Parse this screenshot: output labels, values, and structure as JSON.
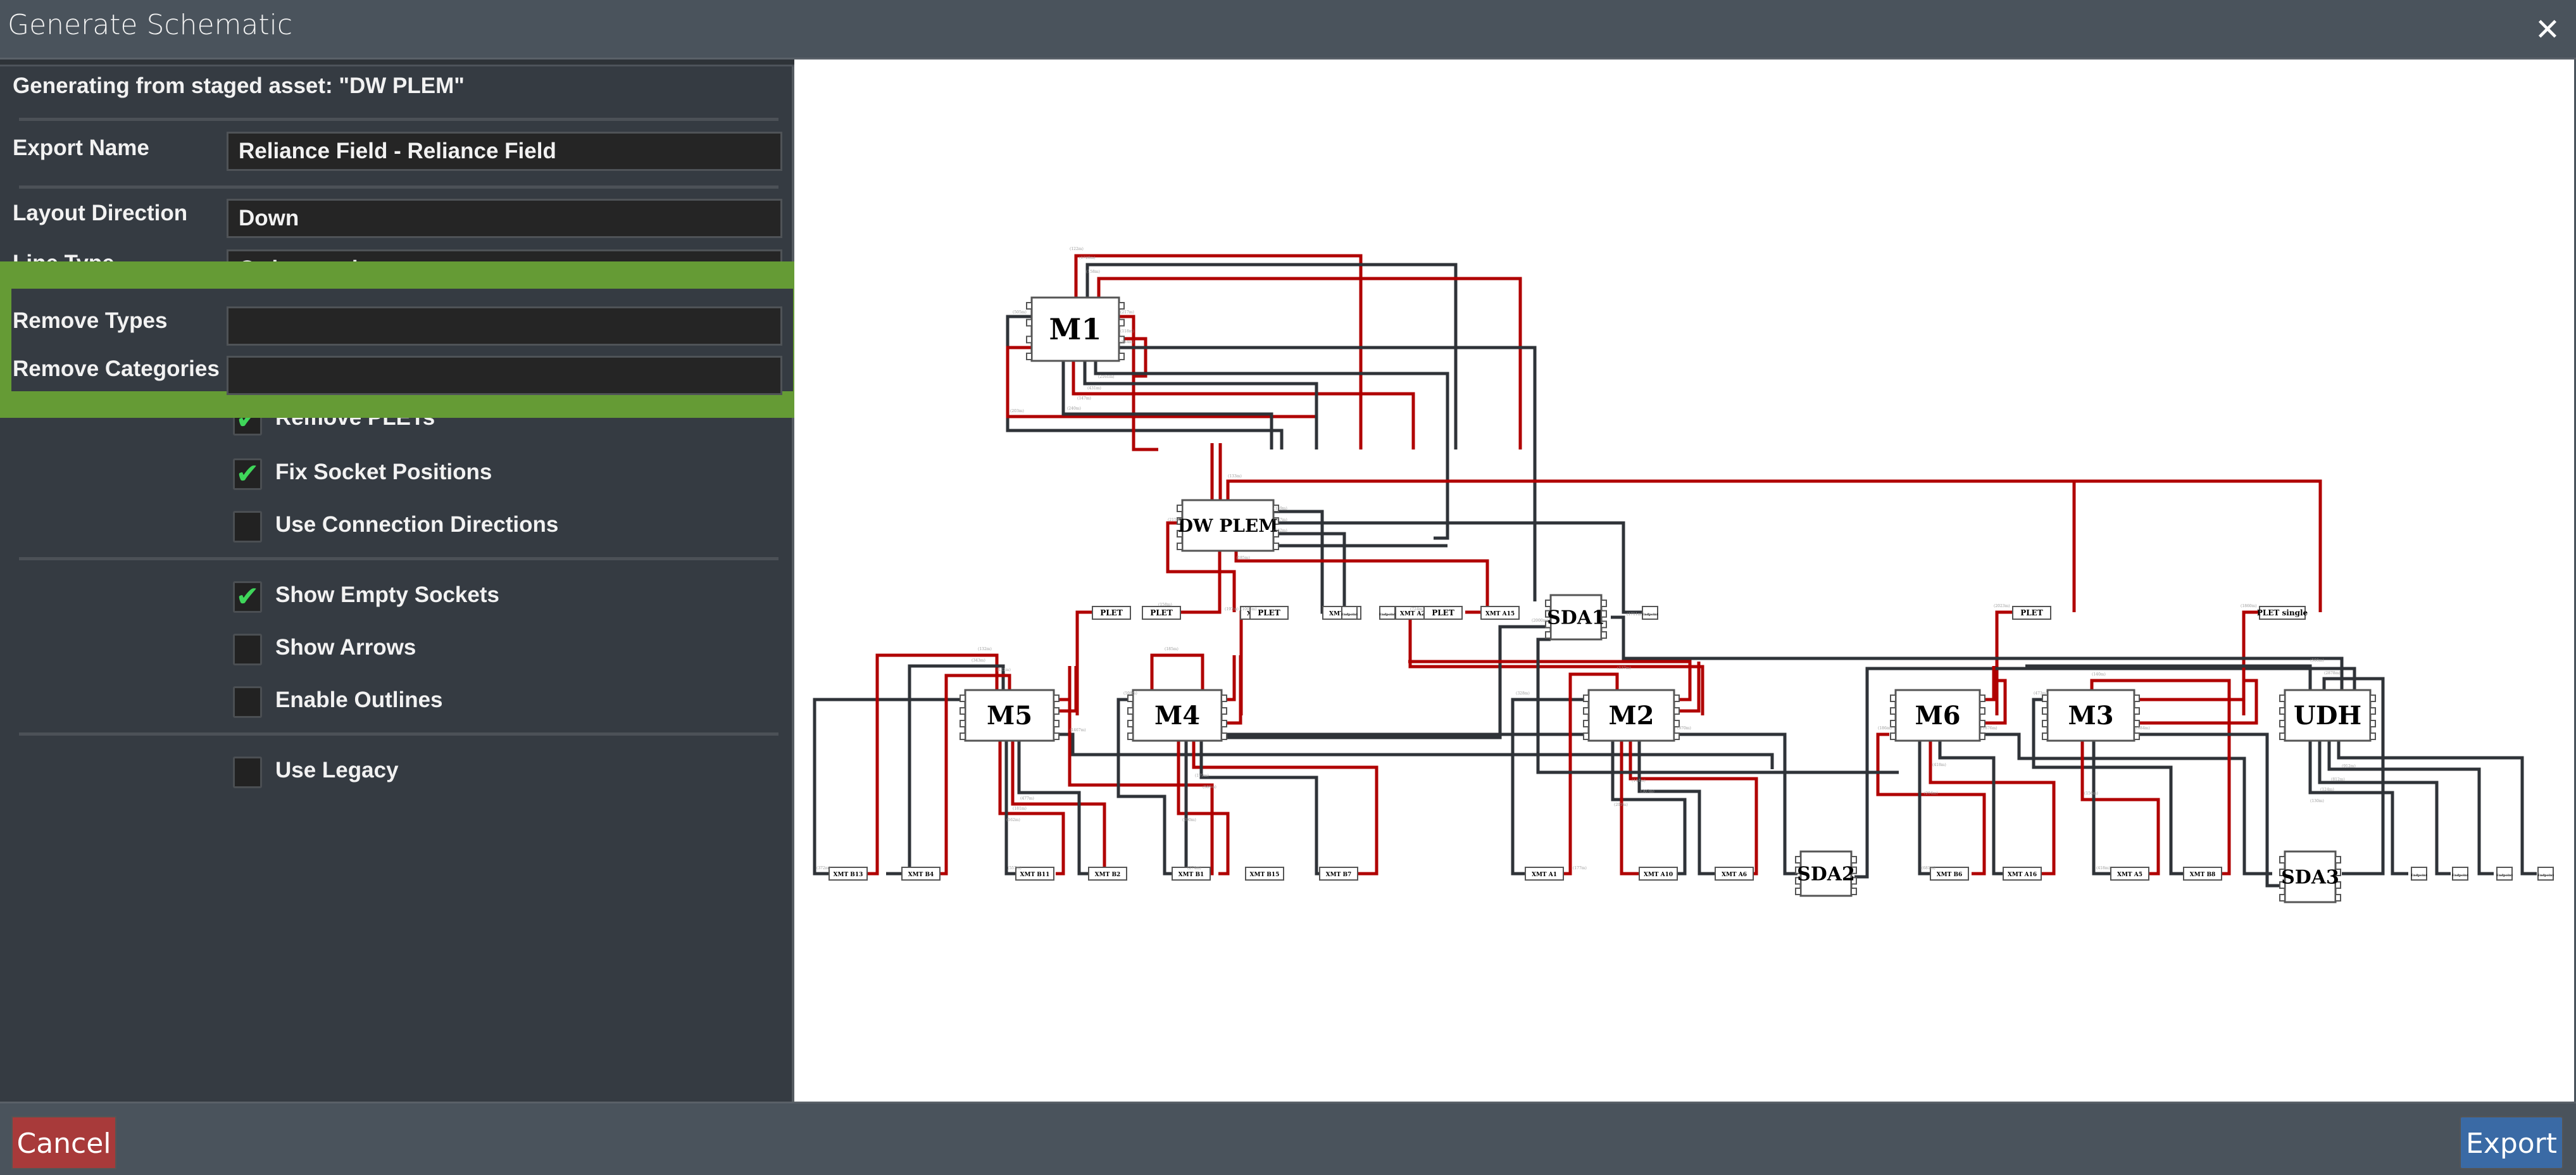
{
  "window": {
    "title": "Generate Schematic",
    "close_icon": "close-icon"
  },
  "panel": {
    "source_text": "Generating from staged asset: \"DW PLEM\"",
    "fields": [
      {
        "label": "Export Name",
        "value": "Reliance Field - Reliance Field"
      },
      {
        "label": "Layout Direction",
        "value": "Down"
      },
      {
        "label": "Line Type",
        "value": "Orthogonal"
      },
      {
        "label": "Remove Types",
        "value": ""
      },
      {
        "label": "Remove Categories",
        "value": ""
      }
    ],
    "checkboxes": [
      {
        "label": "Remove PLETs",
        "checked": true
      },
      {
        "label": "Fix Socket Positions",
        "checked": true
      },
      {
        "label": "Use Connection Directions",
        "checked": false
      },
      {
        "label": "Show Empty Sockets",
        "checked": true
      },
      {
        "label": "Show Arrows",
        "checked": false
      },
      {
        "label": "Enable Outlines",
        "checked": false
      },
      {
        "label": "Use Legacy",
        "checked": false
      }
    ],
    "check_glyph": "✔"
  },
  "footer": {
    "cancel_label": "Cancel",
    "export_label": "Export"
  },
  "colors": {
    "highlight": "#659b35",
    "cancel": "#a83a3a",
    "export": "#3a6aa5",
    "line_red": "#b00000",
    "line_dark": "#2f3338",
    "check": "#3fd65a"
  },
  "schematic": {
    "hubs": [
      {
        "id": "M1",
        "label": "M1"
      },
      {
        "id": "DWPLEM",
        "label": "DW PLEM"
      },
      {
        "id": "SDA1",
        "label": "SDA1"
      },
      {
        "id": "M5",
        "label": "M5"
      },
      {
        "id": "M4",
        "label": "M4"
      },
      {
        "id": "M2",
        "label": "M2"
      },
      {
        "id": "SDA2",
        "label": "SDA2"
      },
      {
        "id": "M6",
        "label": "M6"
      },
      {
        "id": "M3",
        "label": "M3"
      },
      {
        "id": "UDH",
        "label": "UDH"
      },
      {
        "id": "SDA3",
        "label": "SDA3"
      }
    ],
    "small_nodes": [
      {
        "label": "PLET"
      },
      {
        "label": "XMT A9"
      },
      {
        "label": "XMT A2"
      },
      {
        "label": "XMT A20"
      },
      {
        "label": "XMT A15"
      },
      {
        "label": "PLET"
      },
      {
        "label": "PLET"
      },
      {
        "label": "Endpoint"
      },
      {
        "label": "Endpoint"
      },
      {
        "label": "PLET"
      },
      {
        "label": "Endpoint"
      },
      {
        "label": "PLET"
      },
      {
        "label": "PLET single"
      },
      {
        "label": "XMT B13"
      },
      {
        "label": "XMT B4"
      },
      {
        "label": "XMT B11"
      },
      {
        "label": "XMT B2"
      },
      {
        "label": "XMT B1"
      },
      {
        "label": "XMT B15"
      },
      {
        "label": "XMT B7"
      },
      {
        "label": "XMT A1"
      },
      {
        "label": "XMT A10"
      },
      {
        "label": "XMT A6"
      },
      {
        "label": "XMT B6"
      },
      {
        "label": "XMT A16"
      },
      {
        "label": "XMT A5"
      },
      {
        "label": "XMT B8"
      },
      {
        "label": "Endpoint"
      },
      {
        "label": "Endpoint"
      },
      {
        "label": "Endpoint"
      },
      {
        "label": "Endpoint"
      }
    ],
    "length_labels": [
      "(122m)",
      "(1720m)",
      "(158m)",
      "(505m)",
      "(217m)",
      "(118m)",
      "(844m)",
      "(2161m)",
      "(431m)",
      "(147m)",
      "(240m)",
      "(203m)",
      "(158m)",
      "(133m)",
      "(139m)",
      "(537m)",
      "(542m)",
      "(215m)",
      "(185m)",
      "(197m)",
      "(1008m)",
      "(724m)",
      "(2000m)",
      "(1711m)",
      "(132m)",
      "(343m)",
      "(121m)",
      "(185m)",
      "(598m)",
      "(1467m)",
      "(179m)",
      "(585m)",
      "(477m)",
      "(181m)",
      "(162m)",
      "(200m)",
      "(372m)",
      "(557m)",
      "(274m)",
      "(137m)",
      "(328m)",
      "(970m)",
      "(144m)",
      "(307m)",
      "(209m)",
      "(177m)",
      "(140m)",
      "(473m)",
      "(186m)",
      "(1876m)",
      "(418m)",
      "(204m)",
      "(884m)",
      "(156m)",
      "(681m)",
      "(418m)",
      "(508m)",
      "(2878m)",
      "(912m)",
      "(812m)",
      "(124m)",
      "(130m)",
      "(2023m)",
      "(1860m)"
    ]
  }
}
